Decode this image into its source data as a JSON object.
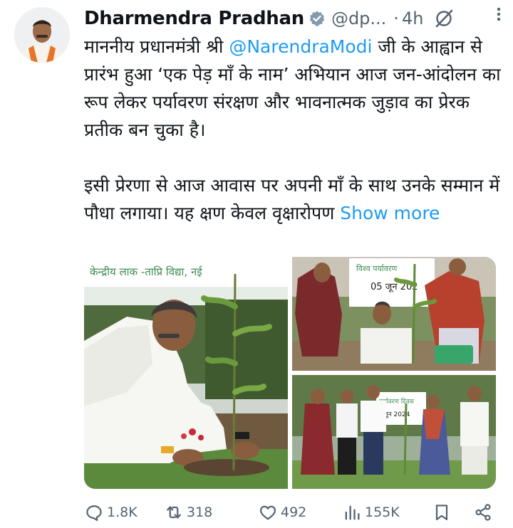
{
  "author": {
    "display_name": "Dharmendra Pradhan",
    "handle": "@dp...",
    "dot": "·",
    "time": "4h"
  },
  "tweet": {
    "paragraph1_before": "माननीय प्रधानमंत्री श्री ",
    "mention": "@NarendraModi",
    "paragraph1_after": " जी के आह्वान से प्रारंभ हुआ ‘एक पेड़ माँ के नाम’ अभियान आज जन-आंदोलन का रूप लेकर पर्यावरण संरक्षण और भावनात्मक जुड़ाव का प्रेरक प्रतीक बन चुका है।",
    "paragraph2": "इसी प्रेरणा से आज आवास पर अपनी माँ के साथ उनके सम्मान में पौधा लगाया। यह क्षण केवल वृक्षारोपण ",
    "show_more": "Show more"
  },
  "media": {
    "banner1": "केन्द्रीय लाक -ताप्रि विद्या, नई",
    "banner2_line1": "विश्व पर्यावरण",
    "banner2_line2": "05 जून 202",
    "banner3_line1": "पर्यावरण दिवस",
    "banner3_line2": "जून 2024"
  },
  "actions": {
    "replies": "1.8K",
    "reposts": "318",
    "likes": "492",
    "views": "155K"
  },
  "colors": {
    "text": "#0f1419",
    "secondary": "#536471",
    "link": "#1d9bf0",
    "verified_badge": "#829aab"
  }
}
